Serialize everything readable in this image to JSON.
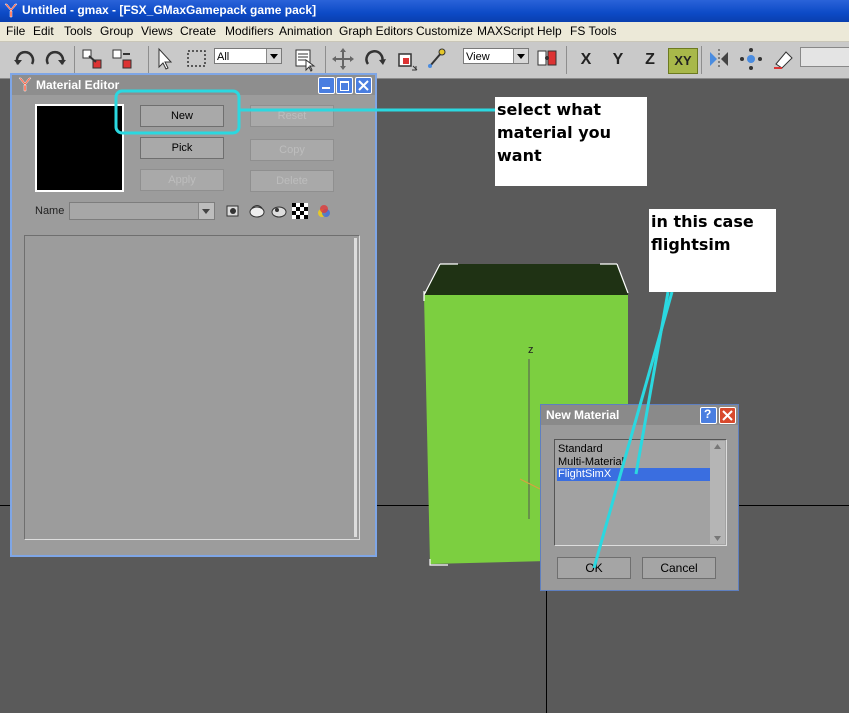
{
  "app": {
    "title": "Untitled - gmax - [FSX_GMaxGamepack game pack]"
  },
  "menu": [
    "File",
    "Edit",
    "Tools",
    "Group",
    "Views",
    "Create",
    "Modifiers",
    "Animation",
    "Graph Editors",
    "Customize",
    "MAXScript",
    "Help",
    "FS Tools"
  ],
  "toolbar": {
    "selection_filter": "All",
    "coord_system": "View",
    "axis_x": "X",
    "axis_y": "Y",
    "axis_z": "Z",
    "axis_xy": "XY"
  },
  "material_editor": {
    "title": "Material Editor",
    "buttons": {
      "new": "New",
      "reset": "Reset",
      "pick": "Pick",
      "copy": "Copy",
      "apply": "Apply",
      "delete": "Delete"
    },
    "name_label": "Name",
    "name_value": ""
  },
  "viewport": {
    "axis_label": "z"
  },
  "new_material_dialog": {
    "title": "New Material",
    "options": [
      "Standard",
      "Multi-Material",
      "FlightSimX"
    ],
    "selected": "FlightSimX",
    "ok": "OK",
    "cancel": "Cancel"
  },
  "annotations": {
    "note1": "select what material you want",
    "note2": "in this case flightsim",
    "highlight_color": "#2bd8e0"
  },
  "colors": {
    "box_green": "#7ccf40",
    "box_top": "#1f3214",
    "selection": "#3a6ee0"
  }
}
